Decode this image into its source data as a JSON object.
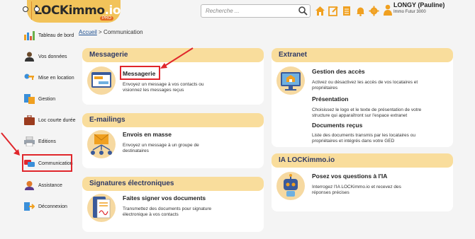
{
  "header": {
    "brand_main": "LOCKimmo",
    "brand_suffix": ".io",
    "brand_badge": "PRO",
    "search_placeholder": "Recherche ...",
    "user_name": "LONGY (Pauline)",
    "user_company": "Immo Futur 3000"
  },
  "sidebar": {
    "items": [
      {
        "label": "Tableau de bord"
      },
      {
        "label": "Vos données"
      },
      {
        "label": "Mise en location"
      },
      {
        "label": "Gestion"
      },
      {
        "label": "Loc courte durée"
      },
      {
        "label": "Editions"
      },
      {
        "label": "Communication"
      },
      {
        "label": "Assistance"
      },
      {
        "label": "Déconnexion"
      }
    ]
  },
  "breadcrumb": {
    "home": "Accueil",
    "separator": ">",
    "current": "Communication"
  },
  "sections": {
    "messagerie": {
      "title": "Messagerie",
      "tile_title": "Messagerie",
      "tile_desc": "Envoyez un message à vos contacts ou visionnez les messages reçus"
    },
    "emailings": {
      "title": "E-mailings",
      "tile_title": "Envois en masse",
      "tile_desc": "Envoyez un message à un groupe de destinataires"
    },
    "signatures": {
      "title": "Signatures électroniques",
      "tile_title": "Faites signer vos documents",
      "tile_desc": "Transmettez des documents pour signature électronique à vos contacts"
    },
    "extranet": {
      "title": "Extranet",
      "items": [
        {
          "title": "Gestion des accès",
          "desc": "Activez ou désactivez les accès de vos locataires et propriétaires"
        },
        {
          "title": "Présentation",
          "desc": "Choisissez le logo et le texte de présentation de votre structure qui apparaîtront sur l'espace extranet"
        },
        {
          "title": "Documents reçus",
          "desc": "Liste des documents transmis par les locataires ou propriétaires et intégrés dans votre GED"
        }
      ]
    },
    "ia": {
      "title": "IA LOCKimmo.io",
      "tile_title": "Posez vos questions à l'IA",
      "tile_desc": "Interrogez l'IA LOCKimmo.io et recevez des réponses précises"
    }
  },
  "colors": {
    "accent": "#f0a020",
    "section_header": "#f9dd9c",
    "highlight": "#e0262b",
    "title_blue": "#2f3a66"
  }
}
